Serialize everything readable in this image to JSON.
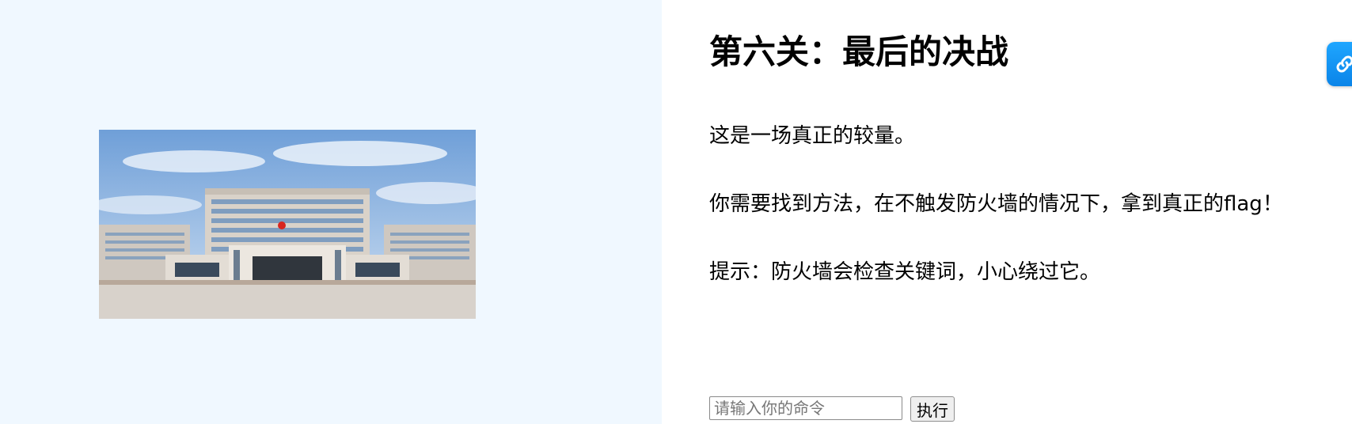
{
  "left": {
    "image_description": "government building photo"
  },
  "main": {
    "title": "第六关：最后的决战",
    "paragraphs": [
      "这是一场真正的较量。",
      "你需要找到方法，在不触发防火墙的情况下，拿到真正的flag！",
      "提示：防火墙会检查关键词，小心绕过它。"
    ]
  },
  "command": {
    "placeholder": "请输入你的命令",
    "value": "",
    "button_label": "执行"
  },
  "widget": {
    "icon": "link-icon",
    "color": "#1fa6ff"
  },
  "colors": {
    "left_bg": "#f0f8ff",
    "right_bg": "#ffffff"
  }
}
